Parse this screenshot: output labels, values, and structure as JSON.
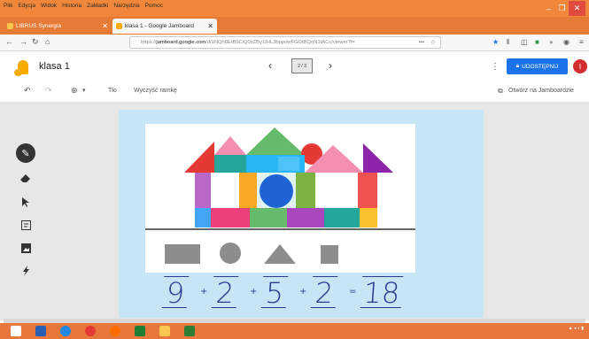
{
  "browser": {
    "menu_items": [
      "Plik",
      "Edycja",
      "Widok",
      "Historia",
      "Zakładki",
      "Narzędzia",
      "Pomoc"
    ],
    "tabs": [
      {
        "title": "LIBRUS Synergia",
        "active": false
      },
      {
        "title": "klasa 1 - Google Jamboard",
        "active": true
      }
    ],
    "url_prefix": "https://",
    "url_domain": "jamboard.google.com",
    "url_rest": "/d/1NQh8EtB9CiQ0zZBy1IHL3bppowFGOtBQnN1tACc/viewer?f=",
    "url_menu": "•••"
  },
  "jamboard": {
    "title": "klasa 1",
    "frame_label": "2 / 3",
    "share_label": "UDOSTĘPNIJ",
    "avatar_letter": "I",
    "toolbar": {
      "zoom_label": "",
      "background_label": "Tło",
      "clear_label": "Wyczyść ramkę",
      "open_label": "Otwórz na Jamboardzie"
    },
    "equation": [
      "9",
      "+",
      "2",
      "+",
      "5",
      "+",
      "2",
      "=",
      "18"
    ]
  },
  "colors": {
    "browser_orange": "#f1873a",
    "share_blue": "#1a73e8",
    "board_blue": "#c6e6f6"
  }
}
